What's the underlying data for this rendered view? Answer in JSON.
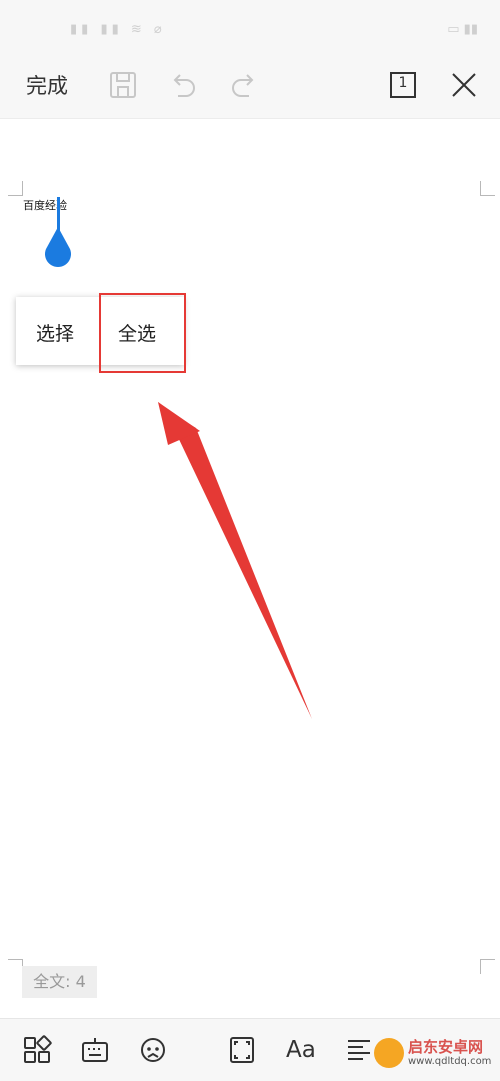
{
  "toolbar": {
    "done_label": "完成",
    "page_number": "1"
  },
  "document": {
    "text": "百度经验",
    "word_count": "全文: 4"
  },
  "context_menu": {
    "items": [
      "选择",
      "全选"
    ],
    "highlighted_item": "全选"
  },
  "bottom_bar": {
    "font_label": "Aa"
  },
  "watermark": {
    "title": "启东安卓网",
    "url": "www.qdltdq.com"
  },
  "colors": {
    "accent": "#1b7be0",
    "highlight": "#e53935",
    "toolbar_bg": "#f7f7f7"
  }
}
